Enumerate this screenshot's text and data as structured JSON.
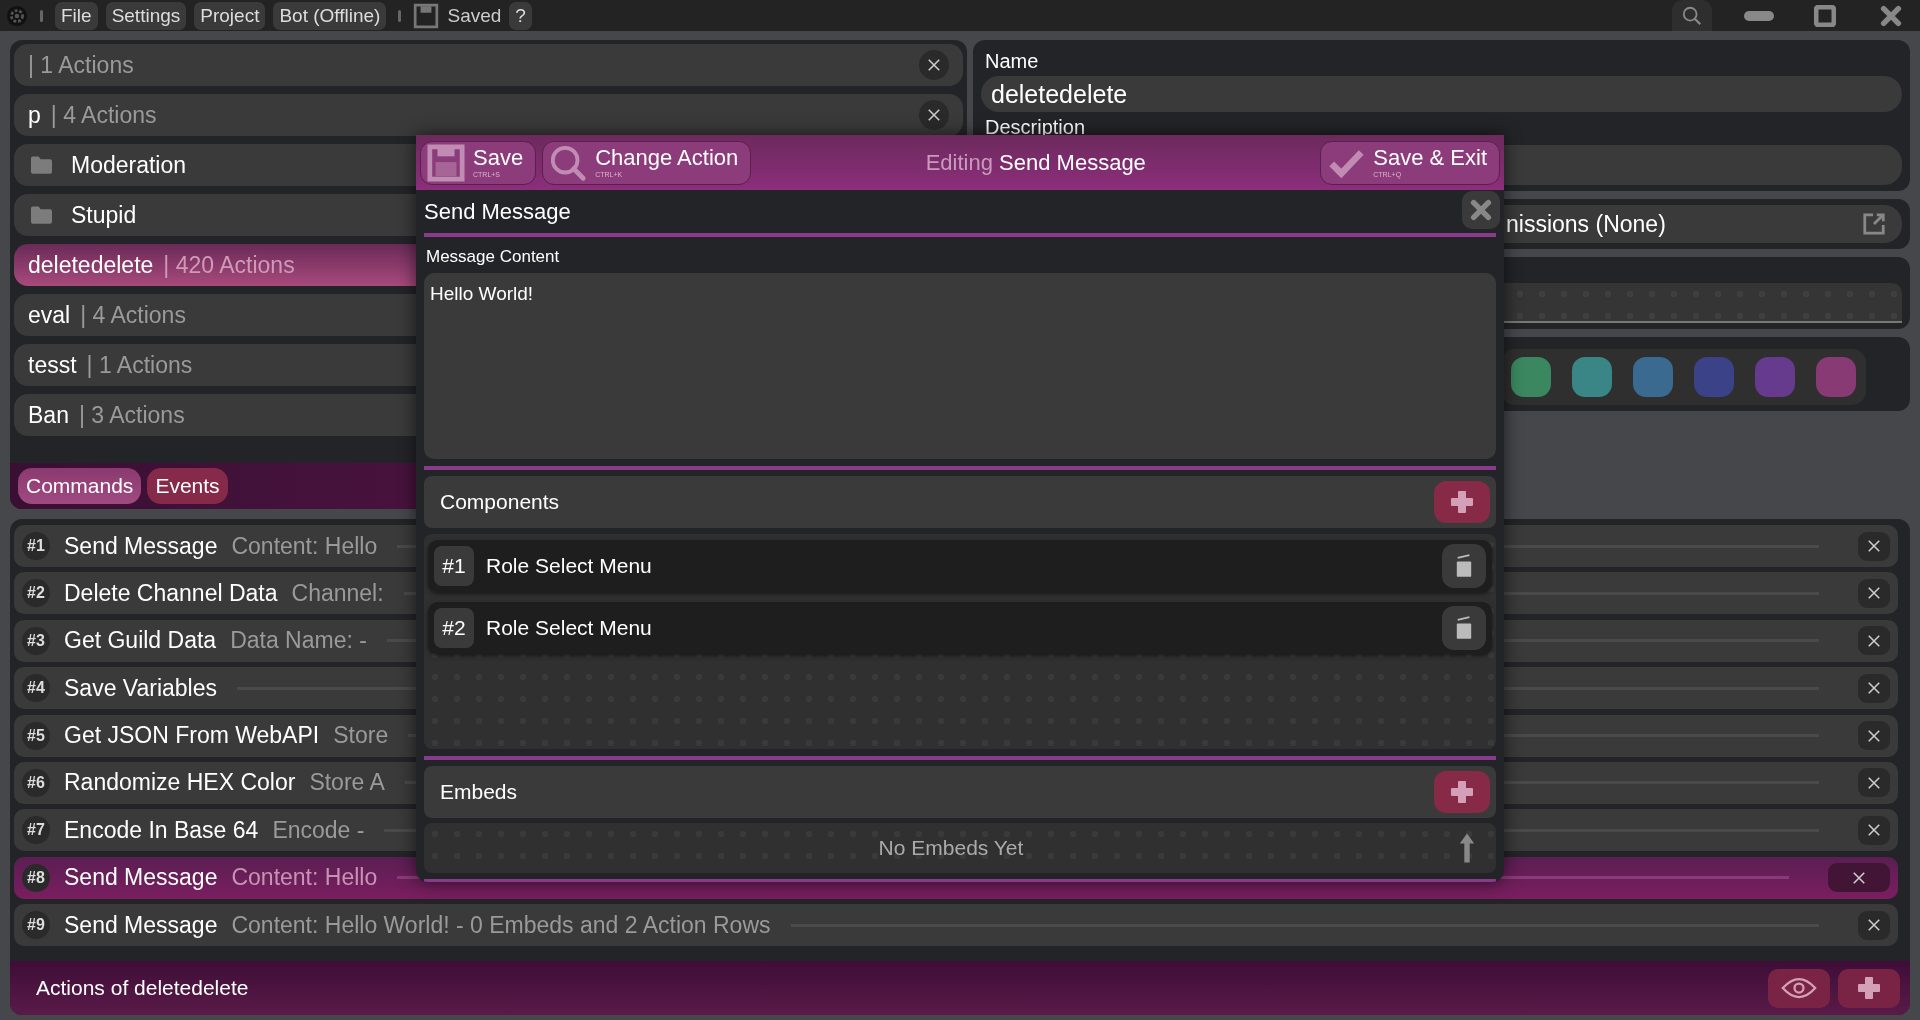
{
  "menu_bar": {
    "items": [
      "File",
      "Settings",
      "Project",
      "Bot (Offline)"
    ],
    "status": "Saved",
    "help": "?"
  },
  "commands": [
    {
      "kind": "command",
      "count": "| 1 Actions",
      "selected": false
    },
    {
      "kind": "command",
      "name": "p",
      "count": "| 4 Actions",
      "selected": false
    },
    {
      "kind": "folder",
      "name": "Moderation",
      "selected": false
    },
    {
      "kind": "folder",
      "name": "Stupid",
      "selected": false
    },
    {
      "kind": "command",
      "name": "deletedelete",
      "count": "| 420 Actions",
      "selected": true
    },
    {
      "kind": "command",
      "name": "eval",
      "count": "| 4 Actions",
      "selected": false
    },
    {
      "kind": "command",
      "name": "tesst",
      "count": "| 1 Actions",
      "selected": false
    },
    {
      "kind": "command",
      "name": "Ban",
      "count": "| 3 Actions",
      "selected": false
    }
  ],
  "tabs": [
    {
      "label": "Commands",
      "selected": true
    },
    {
      "label": "Events",
      "selected": false
    }
  ],
  "details": {
    "name_label": "Name",
    "name_value": "deletedelete",
    "description_label": "Description",
    "permissions": "nissions (None)",
    "colors": [
      {
        "color": "#3a8760"
      },
      {
        "color": "#3a8585"
      },
      {
        "color": "#3a6a90"
      },
      {
        "color": "#3b4288"
      },
      {
        "color": "#663a8c"
      },
      {
        "color": "#873a74"
      }
    ]
  },
  "actions": {
    "rows": [
      {
        "number": "#1",
        "name": "Send Message",
        "summary": "Content: Hello",
        "selected": false
      },
      {
        "number": "#2",
        "name": "Delete Channel Data",
        "summary": "Channel:",
        "selected": false
      },
      {
        "number": "#3",
        "name": "Get Guild Data",
        "summary": "Data Name:  -",
        "selected": false
      },
      {
        "number": "#4",
        "name": "Save Variables",
        "selected": false
      },
      {
        "number": "#5",
        "name": "Get JSON From WebAPI",
        "summary": "Store",
        "selected": false
      },
      {
        "number": "#6",
        "name": "Randomize HEX Color",
        "summary": "Store A",
        "selected": false
      },
      {
        "number": "#7",
        "name": "Encode In Base 64",
        "summary": "Encode  -",
        "selected": false
      },
      {
        "number": "#8",
        "name": "Send Message",
        "summary": "Content: Hello",
        "selected": true
      },
      {
        "number": "#9",
        "name": "Send Message",
        "summary": "Content: Hello World! - 0 Embeds and 2 Action Rows",
        "selected": false
      }
    ],
    "footer": "Actions of deletedelete"
  },
  "editor": {
    "buttons": [
      {
        "kind": "save",
        "label": "Save",
        "shortcut": "CTRL+S"
      },
      {
        "kind": "change",
        "label": "Change Action",
        "shortcut": "CTRL+K"
      },
      {
        "kind": "save_exit",
        "label": "Save & Exit",
        "shortcut": "CTRL+Q"
      }
    ],
    "title_prefix": "Editing",
    "title": "Send Message",
    "action_name": "Send Message",
    "content_label": "Message Content",
    "content_value": "Hello World!",
    "components": {
      "title": "Components",
      "items": [
        {
          "number": "#1",
          "name": "Role Select Menu"
        },
        {
          "number": "#2",
          "name": "Role Select Menu"
        }
      ]
    },
    "embeds": {
      "title": "Embeds",
      "empty": "No Embeds Yet"
    }
  }
}
